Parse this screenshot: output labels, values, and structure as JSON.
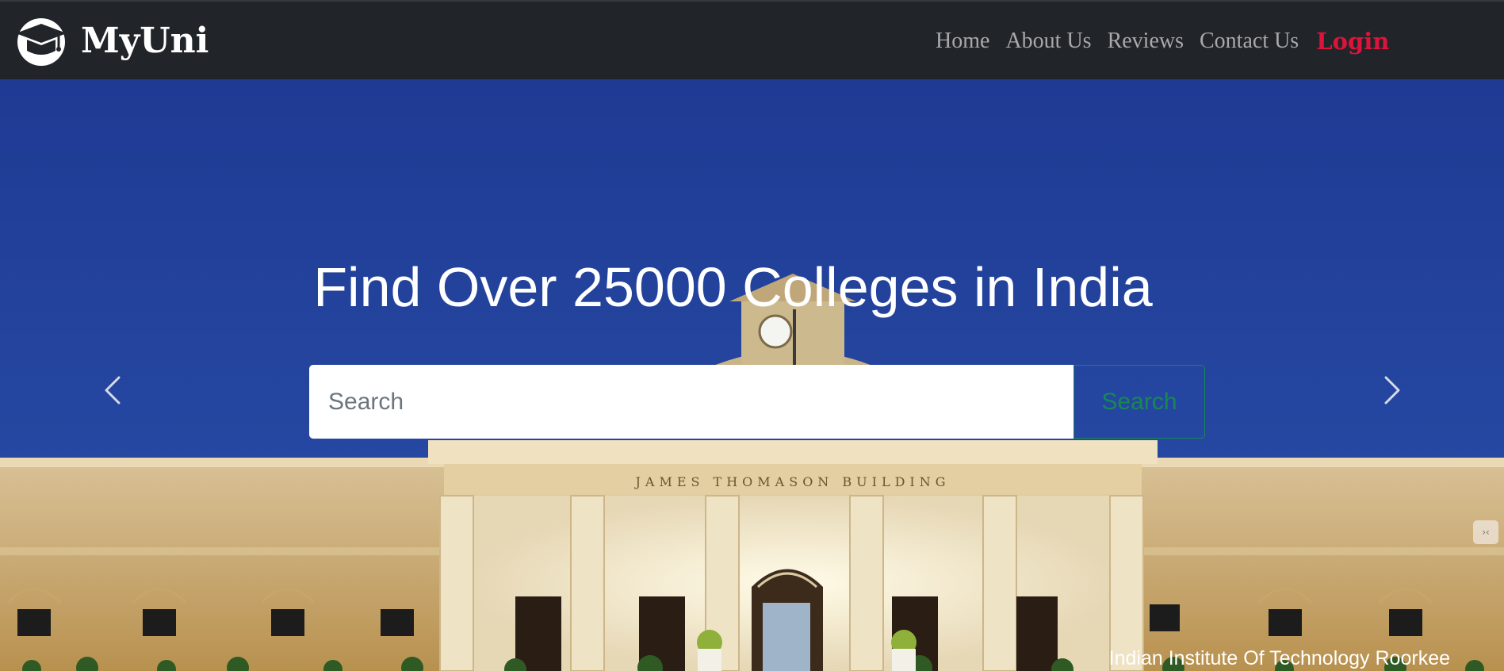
{
  "brand": {
    "name": "MyUni",
    "logo_icon": "graduation-cap-icon"
  },
  "nav": {
    "items": [
      {
        "label": "Home"
      },
      {
        "label": "About Us"
      },
      {
        "label": "Reviews"
      },
      {
        "label": "Contact Us"
      }
    ],
    "login_label": "Login"
  },
  "hero": {
    "title": "Find Over 25000 Colleges in India",
    "search": {
      "placeholder": "Search",
      "value": "",
      "button_label": "Search"
    },
    "prev_icon": "chevron-left-icon",
    "next_icon": "chevron-right-icon",
    "caption": "Indian Institute Of Technology Roorkee"
  },
  "colors": {
    "navbar_bg": "#212529",
    "nav_link": "#a8a9ab",
    "login": "#dc143c",
    "search_button": "#198754",
    "sky": "#223f98"
  }
}
